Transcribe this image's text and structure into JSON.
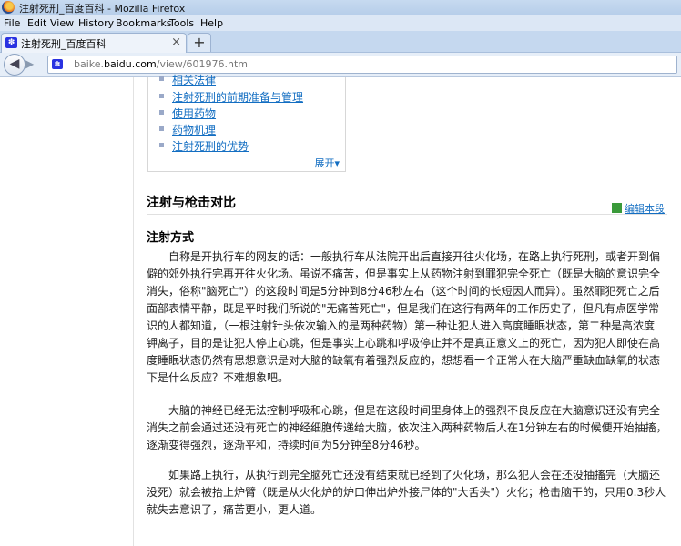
{
  "window": {
    "title": "注射死刑_百度百科 - Mozilla Firefox"
  },
  "menu": [
    "File",
    "Edit",
    "View",
    "History",
    "Bookmarks",
    "Tools",
    "Help"
  ],
  "tab": {
    "title": "注射死刑_百度百科",
    "close": "×",
    "new_tab": "+"
  },
  "nav": {
    "url_prefix": "baike.",
    "url_domain": "baidu.com",
    "url_path": "/view/601976.htm"
  },
  "toc": {
    "items": [
      "相关法律",
      "注射死刑的前期准备与管理",
      "使用药物",
      "药物机理",
      "注射死刑的优势"
    ],
    "more": "展开"
  },
  "section": {
    "title": "注射与枪击对比",
    "edit": "编辑本段",
    "subtitle": "注射方式",
    "paragraphs": [
      [
        "　　自称是开执行车的网友的话：一般执行车从法院开出后直接开往火化场，在路上执行死刑，或者开到偏",
        "僻的郊外执行完再开往火化场。虽说不痛苦，但是事实上从药物注射到罪犯完全死亡（既是大脑的意识完全",
        "消失，俗称\"脑死亡\"）的这段时间是5分钟到8分46秒左右（这个时间的长短因人而异）。虽然罪犯死亡之后",
        "面部表情平静，既是平时我们所说的\"无痛苦死亡\"，但是我们在这行有两年的工作历史了，但凡有点医学常",
        "识的人都知道，（一根注射针头依次输入的是两种药物）第一种让犯人进入高度睡眠状态，第二种是高浓度",
        "钾离子，目的是让犯人停止心跳，但是事实上心跳和呼吸停止并不是真正意义上的死亡，因为犯人即使在高",
        "度睡眠状态仍然有思想意识是对大脑的缺氧有着强烈反应的，想想看一个正常人在大脑严重缺血缺氧的状态",
        "下是什么反应？不难想象吧。"
      ],
      [
        "　　大脑的神经已经无法控制呼吸和心跳，但是在这段时间里身体上的强烈不良反应在大脑意识还没有完全",
        "消失之前会通过还没有死亡的神经细胞传递给大脑，依次注入两种药物后人在1分钟左右的时候便开始抽搐，",
        "逐渐变得强烈，逐渐平和，持续时间为5分钟至8分46秒。"
      ],
      [
        "　　如果路上执行，从执行到完全脑死亡还没有结束就已经到了火化场，那么犯人会在还没抽搐完（大脑还",
        "没死）就会被抬上炉臂（既是从火化炉的炉口伸出炉外接尸体的\"大舌头\"）火化；枪击脑干的，只用0.3秒人",
        "就失去意识了，痛苦更小，更人道。"
      ]
    ]
  }
}
